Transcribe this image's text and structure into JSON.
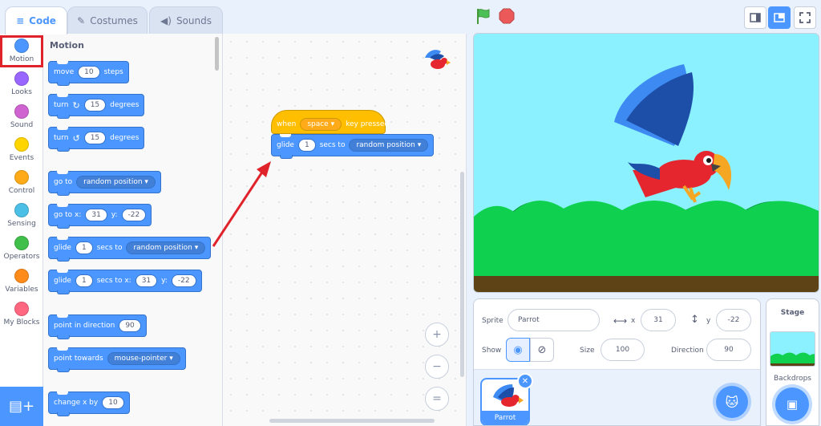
{
  "tabs": [
    {
      "label": "Code",
      "icon": "code-icon",
      "active": true
    },
    {
      "label": "Costumes",
      "icon": "brush-icon",
      "active": false
    },
    {
      "label": "Sounds",
      "icon": "speaker-icon",
      "active": false
    }
  ],
  "categories": [
    {
      "label": "Motion",
      "color": "#4c97ff"
    },
    {
      "label": "Looks",
      "color": "#9966ff"
    },
    {
      "label": "Sound",
      "color": "#cf63cf"
    },
    {
      "label": "Events",
      "color": "#ffd500"
    },
    {
      "label": "Control",
      "color": "#ffab19"
    },
    {
      "label": "Sensing",
      "color": "#4cbfe6"
    },
    {
      "label": "Operators",
      "color": "#40bf4a"
    },
    {
      "label": "Variables",
      "color": "#ff8c1a"
    },
    {
      "label": "My Blocks",
      "color": "#ff6680"
    }
  ],
  "palette": {
    "title": "Motion",
    "move": {
      "a": "move",
      "v": "10",
      "b": "steps"
    },
    "turn_right": {
      "a": "turn",
      "v": "15",
      "b": "degrees"
    },
    "turn_left": {
      "a": "turn",
      "v": "15",
      "b": "degrees"
    },
    "goto": {
      "a": "go to",
      "opt": "random position"
    },
    "goto_xy": {
      "a": "go to x:",
      "x": "31",
      "b": "y:",
      "y": "-22"
    },
    "glide": {
      "a": "glide",
      "v": "1",
      "b": "secs to",
      "opt": "random position"
    },
    "glide_xy": {
      "a": "glide",
      "v": "1",
      "b": "secs to x:",
      "x": "31",
      "c": "y:",
      "y": "-22"
    },
    "point_dir": {
      "a": "point in direction",
      "v": "90"
    },
    "point_towards": {
      "a": "point towards",
      "opt": "mouse-pointer"
    },
    "change_x": {
      "a": "change x by",
      "v": "10"
    }
  },
  "script": {
    "hat": {
      "a": "when",
      "key": "space",
      "b": "key pressed"
    },
    "glide": {
      "a": "glide",
      "v": "1",
      "b": "secs to",
      "opt": "random position"
    }
  },
  "zoom": {
    "in": "+",
    "out": "−",
    "reset": "="
  },
  "sprite_info": {
    "sprite_label": "Sprite",
    "sprite_name": "Parrot",
    "x_label": "x",
    "x": "31",
    "y_label": "y",
    "y": "-22",
    "show_label": "Show",
    "size_label": "Size",
    "size": "100",
    "direction_label": "Direction",
    "direction": "90"
  },
  "sprites": [
    {
      "name": "Parrot",
      "selected": true
    }
  ],
  "stage_panel": {
    "title": "Stage",
    "backdrops_label": "Backdrops"
  },
  "colors": {
    "accent": "#4c97ff",
    "events": "#ffbf00",
    "annotation": "#e0232b"
  }
}
